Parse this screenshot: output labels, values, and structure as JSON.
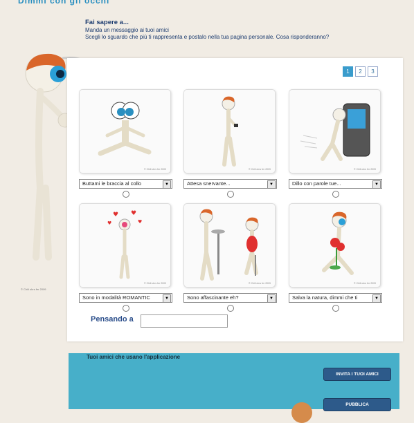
{
  "top": {
    "title": "Dimmi con gli occhi"
  },
  "header": {
    "heading": "Fai sapere a...",
    "line1": "Manda un messaggio ai tuoi amici",
    "line2": "Scegli lo sguardo che più ti rappresenta e postalo nella tua pagina personale. Cosa risponderanno?"
  },
  "copyleft": "© Chili ohrs fer 2009",
  "pager": {
    "pages": [
      "1",
      "2",
      "3"
    ],
    "active": "1"
  },
  "cards": [
    {
      "option": "Buttami le braccia al collo",
      "caption": "© Chili ohrs fer 2009"
    },
    {
      "option": "Attesa snervante...",
      "caption": "© Chili ohrs fer 2009"
    },
    {
      "option": "Dillo con parole tue...",
      "caption": "© Chili ohrs fer 2009"
    },
    {
      "option": "Sono in modalità ROMANTIC",
      "caption": "© Chili ohrs fer 2009"
    },
    {
      "option": "Sono affascinante eh?",
      "caption": "© Chili ohrs fer 2009"
    },
    {
      "option": "Salva la natura, dimmi che ti",
      "caption": "© Chili ohrs fer 2009"
    }
  ],
  "thinking": {
    "label": "Pensando a",
    "value": ""
  },
  "friends": {
    "title": "Tuoi amici che usano l'applicazione",
    "invite_label": "INVITA I TUOI AMICI",
    "publish_label": "PUBBLICA"
  },
  "colors": {
    "background": "#f1ece4",
    "panel": "#ffffff",
    "accent_blue": "#3a9ccc",
    "friends_bg": "#47afc9",
    "button_bg": "#2d5a8a",
    "text_dark_blue": "#1a3a6e"
  }
}
